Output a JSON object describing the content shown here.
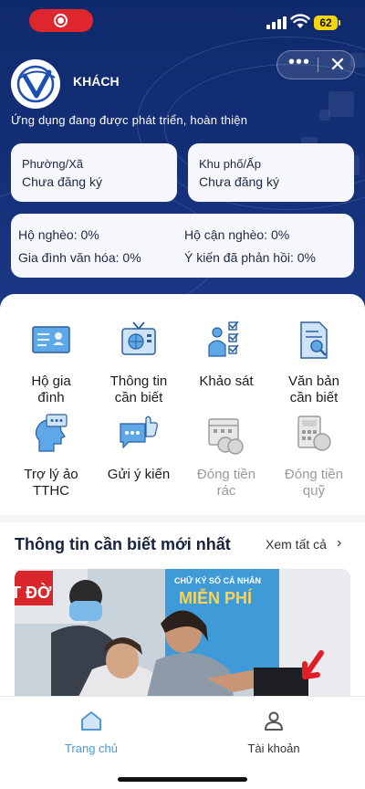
{
  "status_bar": {
    "battery": "62"
  },
  "capsule": {
    "more_label": "•••",
    "close_label": "✕"
  },
  "profile": {
    "name": "KHÁCH",
    "note": "Ứng dụng đang được phát triển, hoàn thiện"
  },
  "location": {
    "ward": {
      "label": "Phường/Xã",
      "value": "Chưa đăng ký"
    },
    "quarter": {
      "label": "Khu phố/Ấp",
      "value": "Chưa đăng ký"
    }
  },
  "stats": {
    "poor": "Hộ nghèo: 0%",
    "near_poor": "Hộ cận nghèo: 0%",
    "cultured_family": "Gia đình văn hóa: 0%",
    "feedback": "Ý kiến đã phản hồi: 0%"
  },
  "menu": {
    "household": {
      "line1": "Hộ gia",
      "line2": "đình",
      "icon": "id-card-icon"
    },
    "info": {
      "line1": "Thông tin",
      "line2": "cần biết",
      "icon": "tv-icon"
    },
    "survey": {
      "line1": "Khảo sát",
      "line2": "",
      "icon": "survey-icon"
    },
    "documents": {
      "line1": "Văn bản",
      "line2": "cần biết",
      "icon": "document-search-icon"
    },
    "assistant": {
      "line1": "Trợ lý ảo",
      "line2": "TTHC",
      "icon": "assistant-head-icon"
    },
    "feedback": {
      "line1": "Gửi ý kiến",
      "line2": "",
      "icon": "chat-thumbs-up-icon"
    },
    "garbage_fee": {
      "line1": "Đóng tiền",
      "line2": "rác",
      "icon": "calendar-coins-icon"
    },
    "fund_fee": {
      "line1": "Đóng tiền",
      "line2": "quỹ",
      "icon": "calculator-coins-icon"
    }
  },
  "news": {
    "title": "Thông tin cần biết mới nhất",
    "see_all": "Xem tất cả",
    "banner_text1": "CHỮ KÝ SỐ CÁ NHÂN",
    "banner_text2": "MIỄN PHÍ",
    "sign_fragment": "T ĐỜ"
  },
  "bottom_nav": {
    "home": "Trang chủ",
    "account": "Tài khoản"
  },
  "colors": {
    "header": "#152f78",
    "active": "#4a9ad6",
    "inactive": "#555555"
  }
}
